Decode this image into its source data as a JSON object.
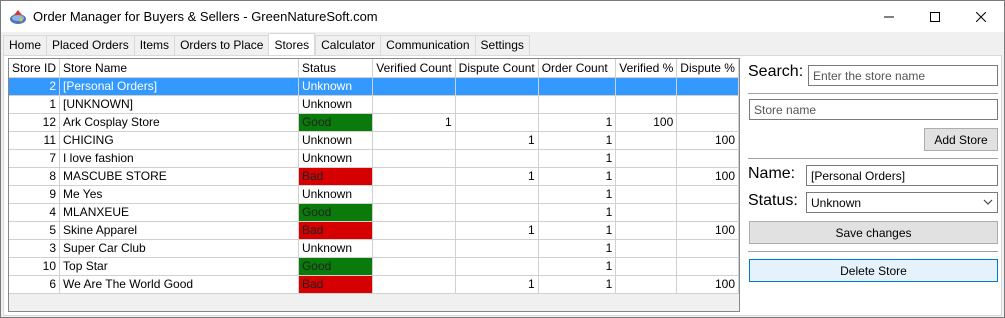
{
  "window": {
    "title": "Order Manager for Buyers & Sellers - GreenNatureSoft.com"
  },
  "tabs": [
    {
      "label": "Home"
    },
    {
      "label": "Placed Orders"
    },
    {
      "label": "Items"
    },
    {
      "label": "Orders to Place"
    },
    {
      "label": "Stores"
    },
    {
      "label": "Calculator"
    },
    {
      "label": "Communication"
    },
    {
      "label": "Settings"
    }
  ],
  "table": {
    "headers": [
      "Store ID",
      "Store Name",
      "Status",
      "Verified Count",
      "Dispute Count",
      "Order Count",
      "Verified %",
      "Dispute %"
    ],
    "rows": [
      {
        "id": "2",
        "name": "[Personal Orders]",
        "status": "Unknown",
        "verified": "",
        "dispute": "",
        "orders": "",
        "verified_pct": "",
        "dispute_pct": ""
      },
      {
        "id": "1",
        "name": "[UNKNOWN]",
        "status": "Unknown",
        "verified": "",
        "dispute": "",
        "orders": "",
        "verified_pct": "",
        "dispute_pct": ""
      },
      {
        "id": "12",
        "name": "Ark Cosplay Store",
        "status": "Good",
        "verified": "1",
        "dispute": "",
        "orders": "1",
        "verified_pct": "100",
        "dispute_pct": ""
      },
      {
        "id": "11",
        "name": "CHICING",
        "status": "Unknown",
        "verified": "",
        "dispute": "1",
        "orders": "1",
        "verified_pct": "",
        "dispute_pct": "100"
      },
      {
        "id": "7",
        "name": "I love fashion",
        "status": "Unknown",
        "verified": "",
        "dispute": "",
        "orders": "1",
        "verified_pct": "",
        "dispute_pct": ""
      },
      {
        "id": "8",
        "name": "MASCUBE STORE",
        "status": "Bad",
        "verified": "",
        "dispute": "1",
        "orders": "1",
        "verified_pct": "",
        "dispute_pct": "100"
      },
      {
        "id": "9",
        "name": "Me Yes",
        "status": "Unknown",
        "verified": "",
        "dispute": "",
        "orders": "1",
        "verified_pct": "",
        "dispute_pct": ""
      },
      {
        "id": "4",
        "name": "MLANXEUE",
        "status": "Good",
        "verified": "",
        "dispute": "",
        "orders": "1",
        "verified_pct": "",
        "dispute_pct": ""
      },
      {
        "id": "5",
        "name": "Skine Apparel",
        "status": "Bad",
        "verified": "",
        "dispute": "1",
        "orders": "1",
        "verified_pct": "",
        "dispute_pct": "100"
      },
      {
        "id": "3",
        "name": "Super Car Club",
        "status": "Unknown",
        "verified": "",
        "dispute": "",
        "orders": "1",
        "verified_pct": "",
        "dispute_pct": ""
      },
      {
        "id": "10",
        "name": "Top Star",
        "status": "Good",
        "verified": "",
        "dispute": "",
        "orders": "1",
        "verified_pct": "",
        "dispute_pct": ""
      },
      {
        "id": "6",
        "name": "We Are The World Good",
        "status": "Bad",
        "verified": "",
        "dispute": "1",
        "orders": "1",
        "verified_pct": "",
        "dispute_pct": "100"
      }
    ]
  },
  "panel": {
    "search_label": "Search:",
    "search_placeholder": "Enter the store name",
    "search_value": "",
    "new_store_placeholder": "Store name",
    "new_store_value": "",
    "add_store_label": "Add Store",
    "name_label": "Name:",
    "name_value": "[Personal Orders]",
    "status_label": "Status:",
    "status_value": "Unknown",
    "save_label": "Save changes",
    "delete_label": "Delete Store"
  },
  "colors": {
    "good": "#0a7a0a",
    "bad": "#d60000",
    "selection": "#3399ff",
    "focus_border": "#0078d7"
  },
  "icons": {
    "app": "app-logo-icon",
    "minimize": "minimize-icon",
    "maximize": "maximize-icon",
    "close": "close-icon",
    "dropdown": "chevron-down-icon"
  }
}
